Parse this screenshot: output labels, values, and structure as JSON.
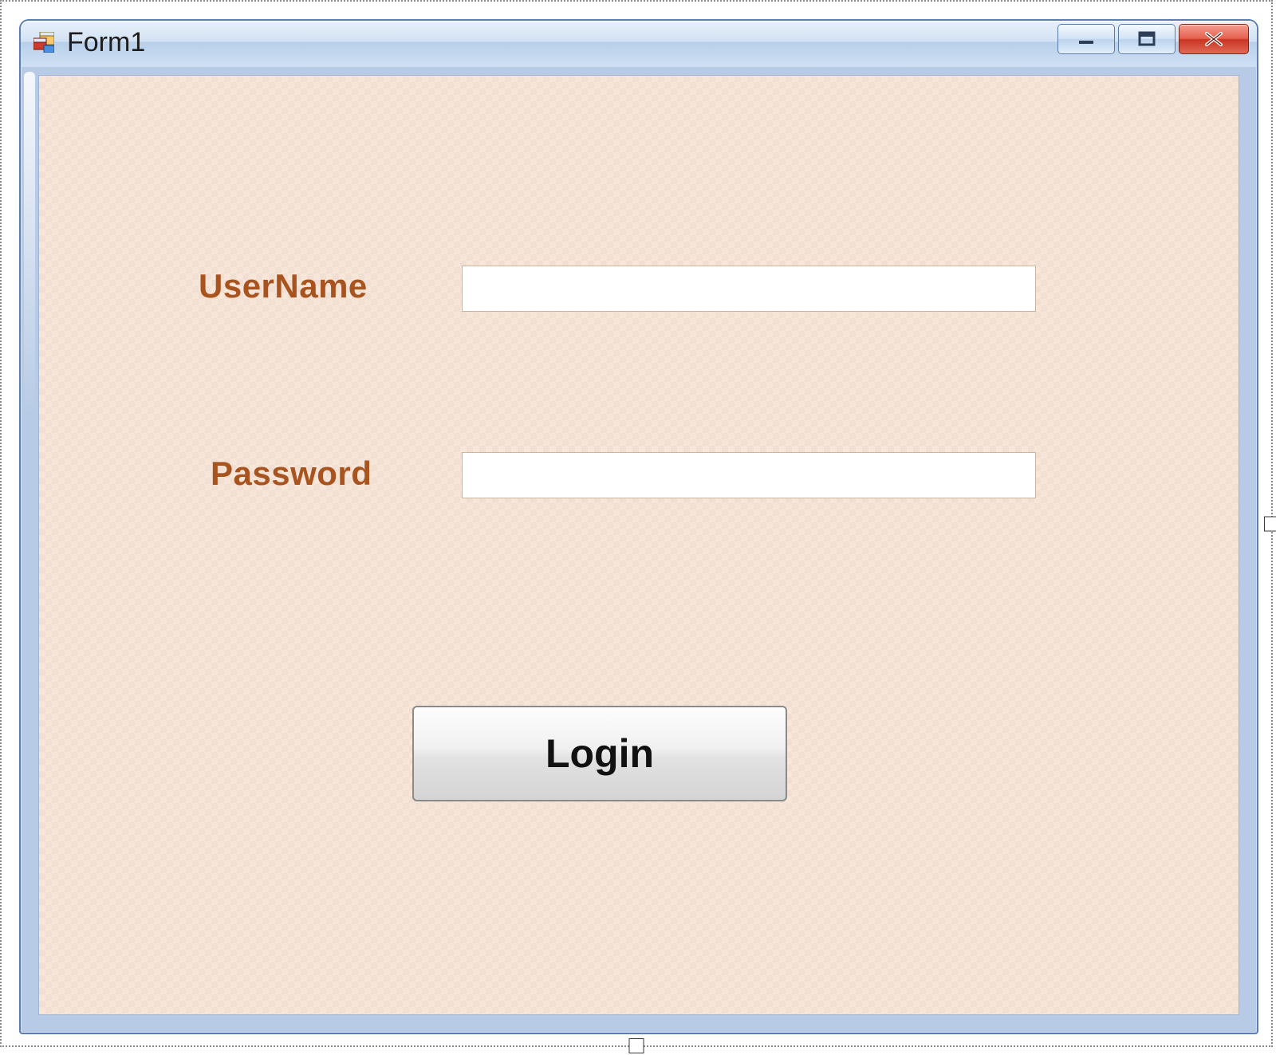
{
  "window": {
    "title": "Form1",
    "icon": "winforms-form-icon",
    "caption_buttons": {
      "minimize": "minimize-icon",
      "maximize": "maximize-icon",
      "close": "close-icon"
    }
  },
  "form": {
    "username": {
      "label": "UserName",
      "value": "",
      "placeholder": ""
    },
    "password": {
      "label": "Password",
      "value": "",
      "placeholder": ""
    },
    "login_button_label": "Login"
  }
}
